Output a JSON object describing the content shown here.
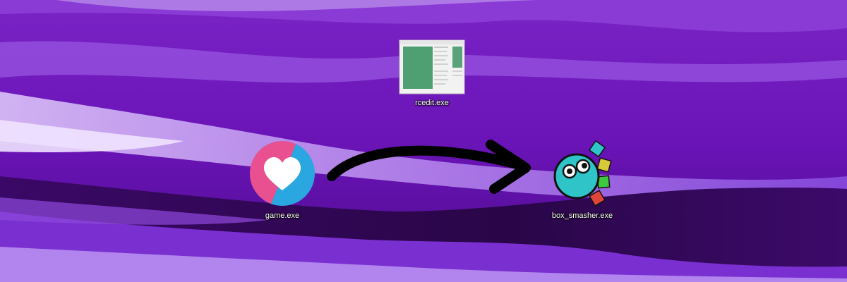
{
  "desktop": {
    "icons": [
      {
        "label": "rcedit.exe",
        "icon": "rcedit-window-icon"
      },
      {
        "label": "game.exe",
        "icon": "heart-icon"
      },
      {
        "label": "box_smasher.exe",
        "icon": "box-smasher-icon"
      }
    ],
    "arrow": {
      "icon": "curved-arrow-icon",
      "color": "#000000"
    }
  },
  "colors": {
    "wallpaper_base": "#6a18b8",
    "wallpaper_light": "#c9a6f2",
    "wallpaper_dark": "#2a0648",
    "game_pink": "#e9508f",
    "game_blue": "#2aa6e0",
    "box_teal": "#2ec4c8",
    "box_squares": [
      "#2ec4c8",
      "#d7c93a",
      "#3cc93e",
      "#e0453a"
    ]
  }
}
